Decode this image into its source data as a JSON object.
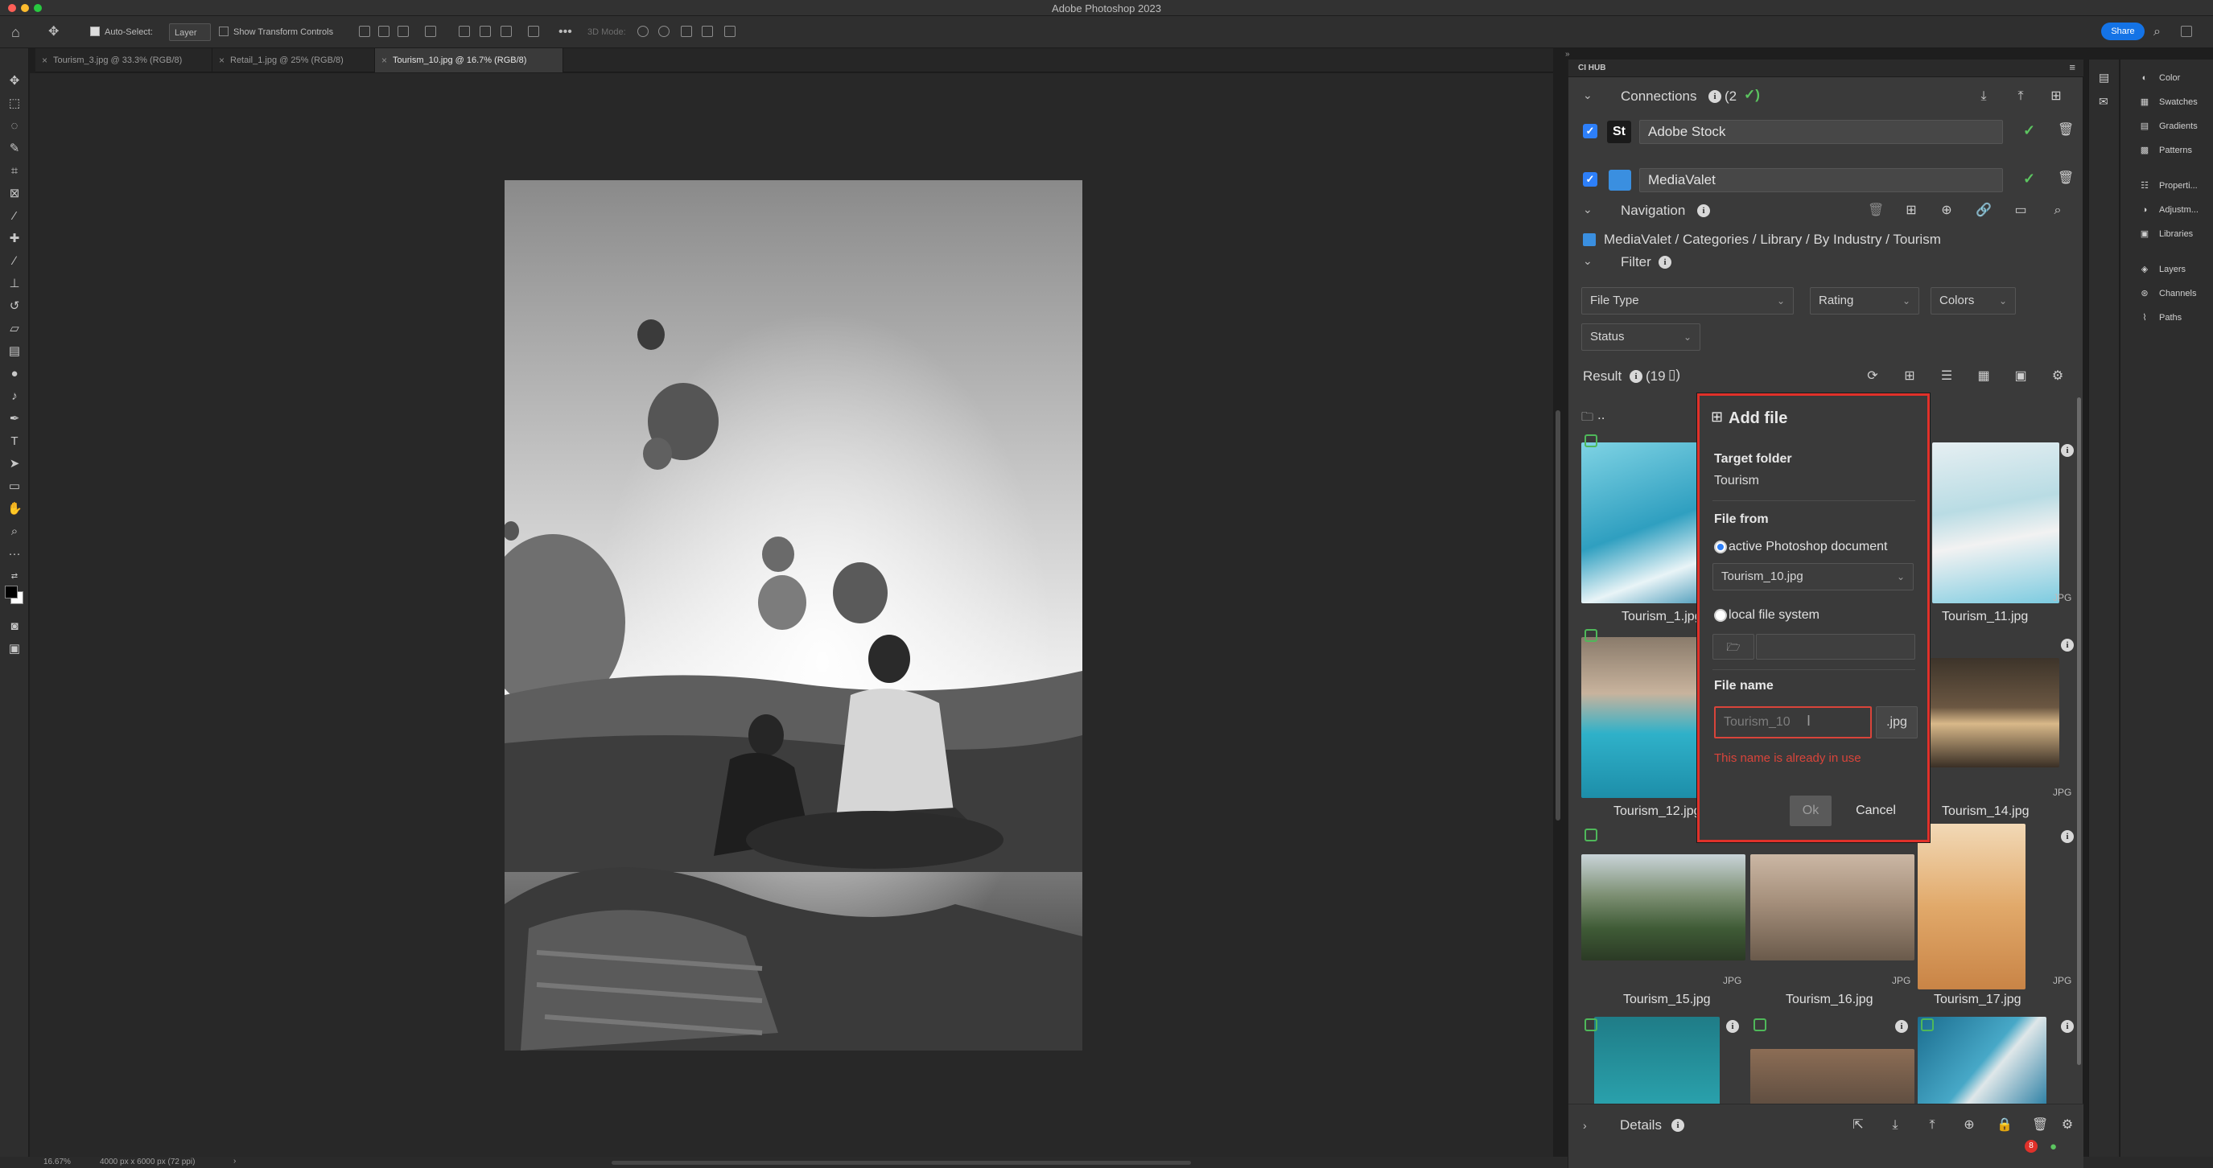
{
  "app": {
    "title": "Adobe Photoshop 2023"
  },
  "options": {
    "auto_select_label": "Auto-Select:",
    "layer_value": "Layer",
    "show_transform_label": "Show Transform Controls",
    "mode_label": "3D Mode:",
    "share_label": "Share"
  },
  "doc_tabs": [
    {
      "label": "Tourism_3.jpg @ 33.3% (RGB/8)"
    },
    {
      "label": "Retail_1.jpg @ 25% (RGB/8)"
    },
    {
      "label": "Tourism_10.jpg @ 16.7% (RGB/8)"
    }
  ],
  "status": {
    "zoom": "16.67%",
    "size": "4000 px x 6000 px (72 ppi)"
  },
  "panel": {
    "title": "CI HUB",
    "connections": {
      "label": "Connections",
      "count": "(2"
    },
    "sources": [
      {
        "badge": "St",
        "name": "Adobe Stock"
      },
      {
        "badge": "",
        "name": "MediaValet"
      }
    ],
    "navigation": {
      "label": "Navigation",
      "path": "MediaValet / Categories / Library / By Industry / Tourism"
    },
    "filter": {
      "label": "Filter",
      "dropdowns": [
        "File Type",
        "Rating",
        "Colors",
        "Status"
      ]
    },
    "result": {
      "label": "Result",
      "count": "(19"
    },
    "parent_folder": "..",
    "thumbs": [
      {
        "caption": "Tourism_1.jpg"
      },
      {
        "caption": "Tourism_11.jpg",
        "ext": "JPG"
      },
      {
        "caption": "Tourism_12.jpg"
      },
      {
        "caption": "Tourism_14.jpg",
        "ext": "JPG"
      },
      {
        "caption": "Tourism_15.jpg",
        "ext": "JPG"
      },
      {
        "caption": "Tourism_16.jpg",
        "ext": "JPG"
      },
      {
        "caption": "Tourism_17.jpg",
        "ext": "JPG"
      }
    ],
    "details_label": "Details",
    "notification_count": "8"
  },
  "add_file": {
    "title": "Add file",
    "target_folder_label": "Target folder",
    "target_folder_value": "Tourism",
    "file_from_label": "File from",
    "option_active": "active Photoshop document",
    "active_doc_value": "Tourism_10.jpg",
    "option_local": "local file system",
    "file_name_label": "File name",
    "file_name_value": "Tourism_10",
    "extension": ".jpg",
    "error": "This name is already in use",
    "ok_label": "Ok",
    "cancel_label": "Cancel"
  },
  "dock": [
    {
      "icon": "color-icon",
      "label": "Color"
    },
    {
      "icon": "swatches-icon",
      "label": "Swatches"
    },
    {
      "icon": "gradients-icon",
      "label": "Gradients"
    },
    {
      "icon": "patterns-icon",
      "label": "Patterns"
    },
    {
      "icon": "properties-icon",
      "label": "Properti..."
    },
    {
      "icon": "adjustments-icon",
      "label": "Adjustm..."
    },
    {
      "icon": "libraries-icon",
      "label": "Libraries"
    },
    {
      "icon": "layers-icon",
      "label": "Layers"
    },
    {
      "icon": "channels-icon",
      "label": "Channels"
    },
    {
      "icon": "paths-icon",
      "label": "Paths"
    }
  ],
  "colors": {
    "accent": "#2d7ff9",
    "error": "#e0312a",
    "success": "#5cc560"
  }
}
